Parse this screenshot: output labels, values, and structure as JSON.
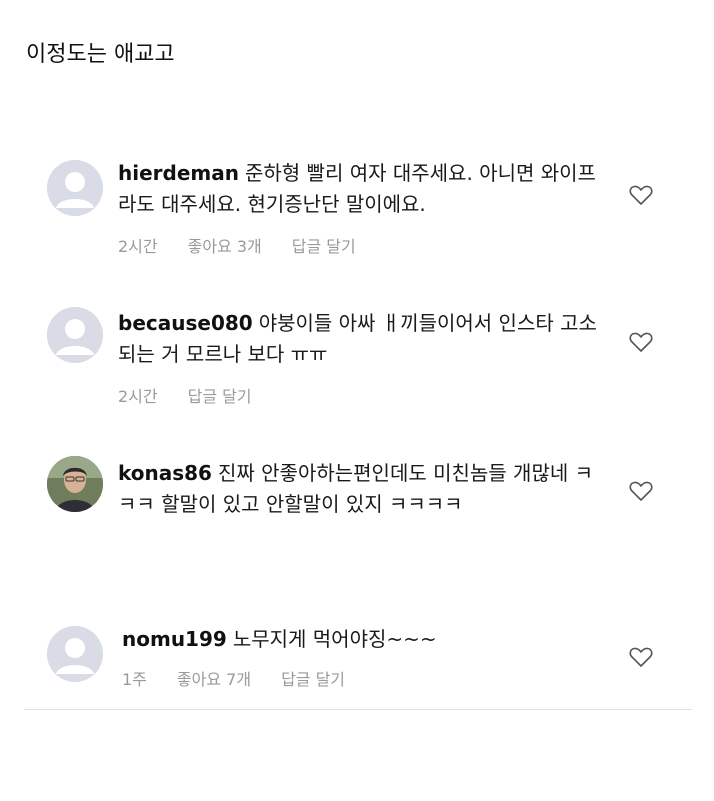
{
  "page": {
    "title": "이정도는 애교고"
  },
  "comments": [
    {
      "username": "hierdeman",
      "text": "준하형 빨리 여자 대주세요. 아니면 와이프라도 대주세요. 현기증난단 말이에요.",
      "time": "2시간",
      "likes": "좋아요 3개",
      "reply": "답글 달기",
      "avatar": "default-avatar-icon"
    },
    {
      "username": "because080",
      "text": "야붕이들 아싸 ㅐ끼들이어서 인스타 고소되는 거 모르나 보다 ㅠㅠ",
      "time": "2시간",
      "likes": "",
      "reply": "답글 달기",
      "avatar": "default-avatar-icon"
    },
    {
      "username": "konas86",
      "text": "진짜 안좋아하는편인데도 미친놈들 개많네 ㅋㅋㅋ 할말이 있고 안할말이 있지 ㅋㅋㅋㅋ",
      "time": "",
      "likes": "",
      "reply": "",
      "avatar": "photo-avatar"
    },
    {
      "username": "nomu199",
      "text": "노무지게 먹어야징~~~",
      "time": "1주",
      "likes": "좋아요 7개",
      "reply": "답글 달기",
      "avatar": "default-avatar-icon"
    }
  ],
  "colors": {
    "avatar_bg": "#d9dbe6",
    "meta_text": "#9a9a9a",
    "divider": "#e2e2e2"
  }
}
